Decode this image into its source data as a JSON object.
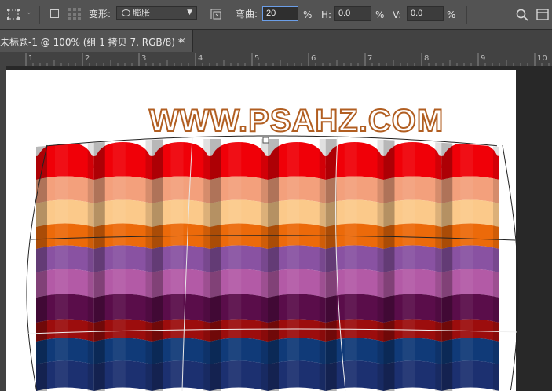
{
  "toolbar": {
    "transform_label": "变形:",
    "warp_style": "膨胀",
    "bend_label": "弯曲:",
    "bend_value": "20",
    "bend_unit": "%",
    "h_label": "H:",
    "h_value": "0.0",
    "h_unit": "%",
    "v_label": "V:",
    "v_value": "0.0",
    "v_unit": "%"
  },
  "document": {
    "tab_title": "未标题-1 @ 100% (组 1 拷贝 7, RGB/8) *",
    "close_glyph": "×"
  },
  "ruler": {
    "labels": [
      "1",
      "2",
      "3",
      "4",
      "5",
      "6",
      "7",
      "8",
      "9",
      "10"
    ]
  },
  "canvas": {
    "watermark": "WWW.PSAHZ.COM"
  },
  "artwork": {
    "stripe_colors": [
      "#f00008",
      "#f3a07c",
      "#fbc98a",
      "#ec6a0a",
      "#8952a2",
      "#b35aa6",
      "#5a0d4a",
      "#9c0d0d",
      "#103a78",
      "#1c3070"
    ],
    "panel_count": 8
  },
  "colors": {
    "options_bar": "#535353",
    "workspace": "#282828",
    "watermark_outline": "#b15e21",
    "focus": "#6b9ee8"
  }
}
